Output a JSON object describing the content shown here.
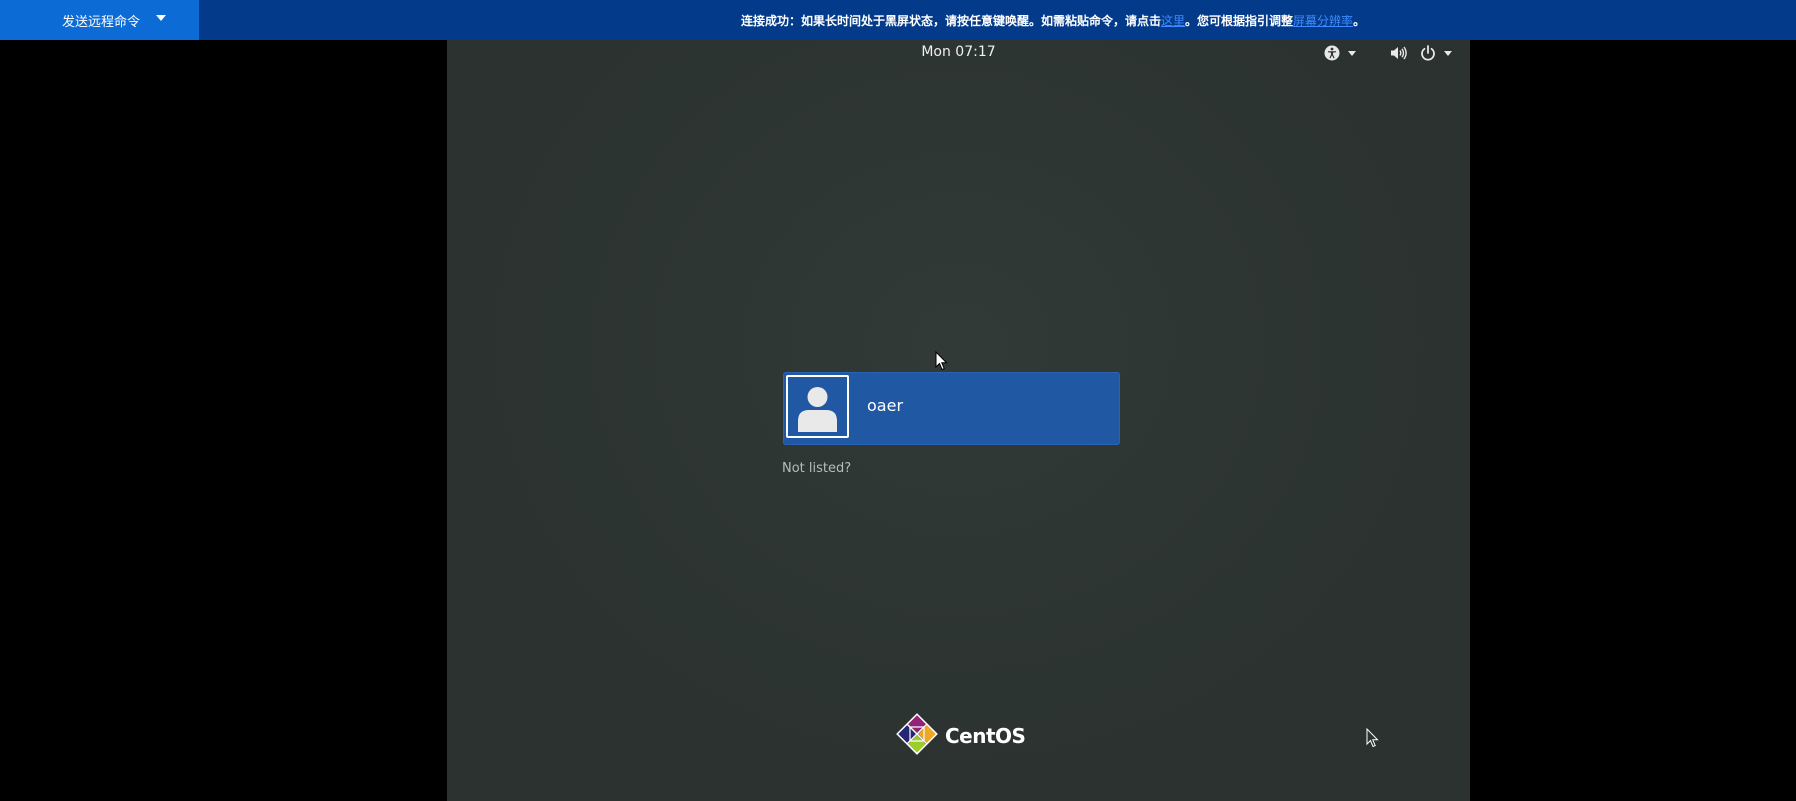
{
  "remote_bar": {
    "command_button_label": "发送远程命令",
    "notice_text_before": "连接成功：如果长时间处于黑屏状态，请按任意键唤醒。如需粘贴命令，请点击",
    "notice_link_here": "这里",
    "notice_text_middle": "。您可根据指引调整",
    "notice_link_resolution": "屏幕分辨率",
    "notice_text_after": "。"
  },
  "login_screen": {
    "clock": "Mon 07:17",
    "tray_icons": [
      "accessibility-icon",
      "volume-icon",
      "power-icon"
    ],
    "user": {
      "name": "oaer",
      "avatar": "default-user-icon"
    },
    "not_listed_label": "Not listed?",
    "brand_name": "CentOS"
  },
  "colors": {
    "remote_bar_bg": "#033b8a",
    "command_button_bg": "#0c6bd4",
    "screen_bg": "#2c3331",
    "user_card_bg": "#2058a3",
    "link": "#3d8bff"
  }
}
